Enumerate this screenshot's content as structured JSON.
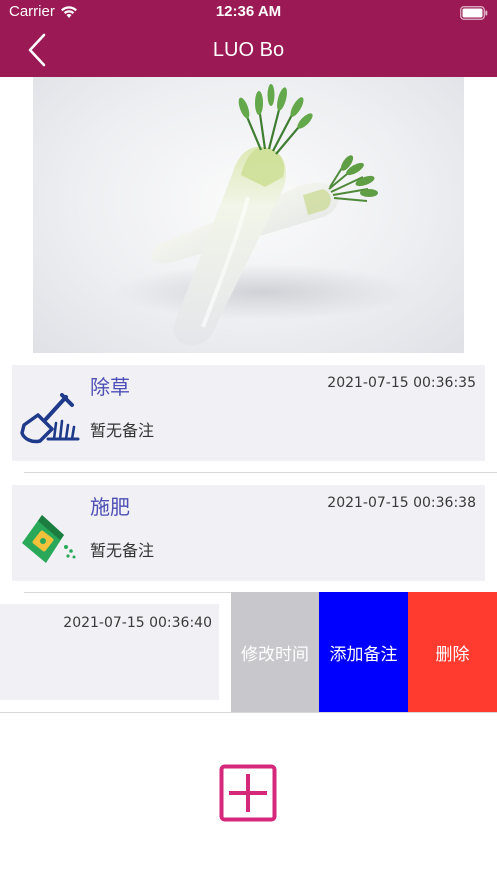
{
  "status_bar": {
    "carrier": "Carrier",
    "time": "12:36 AM"
  },
  "nav": {
    "title": "LUO Bo",
    "back_icon": "chevron-left-icon"
  },
  "colors": {
    "nav_bg": "#9b1a55",
    "row_bg": "#f1f0f5",
    "task_name": "#4d4fb5",
    "edit_time_bg": "#c7c7cc",
    "add_note_bg": "#0000fe",
    "delete_bg": "#ff3b30",
    "add_button": "#d6287b"
  },
  "hero": {
    "image": "white radish (daikon) photo"
  },
  "records": [
    {
      "name": "除草",
      "time": "2021-07-15 00:36:35",
      "note": "暂无备注",
      "icon": "shovel-weeding-icon"
    },
    {
      "name": "施肥",
      "time": "2021-07-15 00:36:38",
      "note": "暂无备注",
      "icon": "fertilizer-bag-icon"
    },
    {
      "time": "2021-07-15 00:36:40"
    }
  ],
  "swipe_actions": {
    "edit_time": "修改时间",
    "add_note": "添加备注",
    "delete": "删除"
  },
  "add_button": {
    "icon": "plus-square-icon"
  }
}
